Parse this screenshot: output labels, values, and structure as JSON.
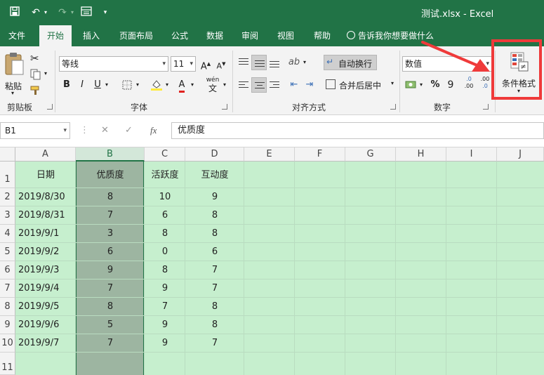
{
  "window": {
    "title": "测试.xlsx  -  Excel"
  },
  "tabs": [
    {
      "label": "文件"
    },
    {
      "label": "开始"
    },
    {
      "label": "插入"
    },
    {
      "label": "页面布局"
    },
    {
      "label": "公式"
    },
    {
      "label": "数据"
    },
    {
      "label": "审阅"
    },
    {
      "label": "视图"
    },
    {
      "label": "帮助"
    }
  ],
  "tell_me": "告诉我你想要做什么",
  "ribbon": {
    "clipboard": {
      "paste_label": "粘贴",
      "group_label": "剪贴板"
    },
    "font": {
      "font_name": "等线",
      "font_size": "11",
      "grow": "A",
      "shrink": "A",
      "bold": "B",
      "italic": "I",
      "underline": "U",
      "font_color_letter": "A",
      "fill_letter": "A",
      "phonetic": "wén",
      "group_label": "字体"
    },
    "alignment": {
      "wrap_text": "自动换行",
      "merge_center": "合并后居中",
      "group_label": "对齐方式"
    },
    "number": {
      "format": "数值",
      "percent": "%",
      "comma": "9",
      "inc_decimal": ".0",
      "dec_decimal": ".00",
      "group_label": "数字"
    },
    "styles": {
      "conditional_format": "条件格式"
    },
    "accent": "#217346",
    "highlight_color": "#ef3a3a"
  },
  "formula_bar": {
    "name_box": "B1",
    "cancel": "✕",
    "enter": "✓",
    "fx": "fx",
    "content": "优质度"
  },
  "grid": {
    "columns": [
      "A",
      "B",
      "C",
      "D",
      "E",
      "F",
      "G",
      "H",
      "I",
      "J"
    ],
    "selected_column": "B",
    "row_numbers": [
      "1",
      "2",
      "3",
      "4",
      "5",
      "6",
      "7",
      "8",
      "9",
      "10",
      "11"
    ],
    "headers": [
      "日期",
      "优质度",
      "活跃度",
      "互动度"
    ],
    "rows": [
      {
        "date": "2019/8/30",
        "b": "8",
        "c": "10",
        "d": "9"
      },
      {
        "date": "2019/8/31",
        "b": "7",
        "c": "6",
        "d": "8"
      },
      {
        "date": "2019/9/1",
        "b": "3",
        "c": "8",
        "d": "8"
      },
      {
        "date": "2019/9/2",
        "b": "6",
        "c": "0",
        "d": "6"
      },
      {
        "date": "2019/9/3",
        "b": "9",
        "c": "8",
        "d": "7"
      },
      {
        "date": "2019/9/4",
        "b": "7",
        "c": "9",
        "d": "7"
      },
      {
        "date": "2019/9/5",
        "b": "8",
        "c": "7",
        "d": "8"
      },
      {
        "date": "2019/9/6",
        "b": "5",
        "c": "9",
        "d": "8"
      },
      {
        "date": "2019/9/7",
        "b": "7",
        "c": "9",
        "d": "7"
      }
    ],
    "fill_color": "#c6efce",
    "selected_fill": "#9db5a1"
  }
}
